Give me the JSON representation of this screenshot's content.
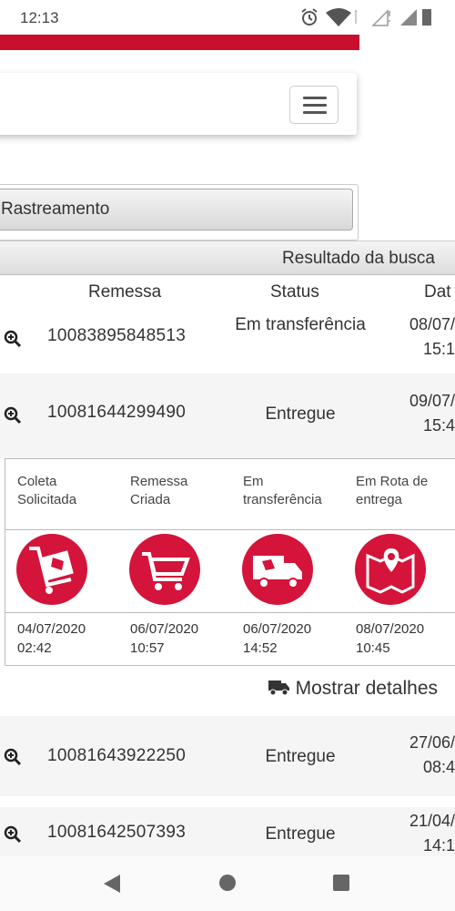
{
  "statusbar": {
    "time": "12:13"
  },
  "search_panel": {
    "button_label": "Rastreamento"
  },
  "results": {
    "title": "Resultado da busca",
    "columns": [
      "Remessa",
      "Status",
      "Dat"
    ],
    "rows": [
      {
        "remessa": "10083895848513",
        "status": "Em transferência",
        "date": "08/07/",
        "time": "15:1"
      },
      {
        "remessa": "10081644299490",
        "status": "Entregue",
        "date": "09/07/",
        "time": "15:4"
      },
      {
        "remessa": "10081643922250",
        "status": "Entregue",
        "date": "27/06/",
        "time": "08:4"
      },
      {
        "remessa": "10081642507393",
        "status": "Entregue",
        "date": "21/04/",
        "time": "14:1"
      }
    ]
  },
  "timeline": {
    "steps": [
      {
        "label1": "Coleta",
        "label2": "Solicitada",
        "date": "04/07/2020",
        "time": "02:42",
        "icon": "cart-package-icon"
      },
      {
        "label1": "Remessa",
        "label2": "Criada",
        "date": "06/07/2020",
        "time": "10:57",
        "icon": "shopping-cart-icon"
      },
      {
        "label1": "Em",
        "label2": "transferência",
        "date": "06/07/2020",
        "time": "14:52",
        "icon": "truck-icon"
      },
      {
        "label1": "Em Rota de",
        "label2": "entrega",
        "date": "08/07/2020",
        "time": "10:45",
        "icon": "map-pin-icon"
      }
    ],
    "accent": "#d4143a"
  },
  "details_link": "Mostrar detalhes",
  "colors": {
    "brand_red": "#c8102e"
  }
}
